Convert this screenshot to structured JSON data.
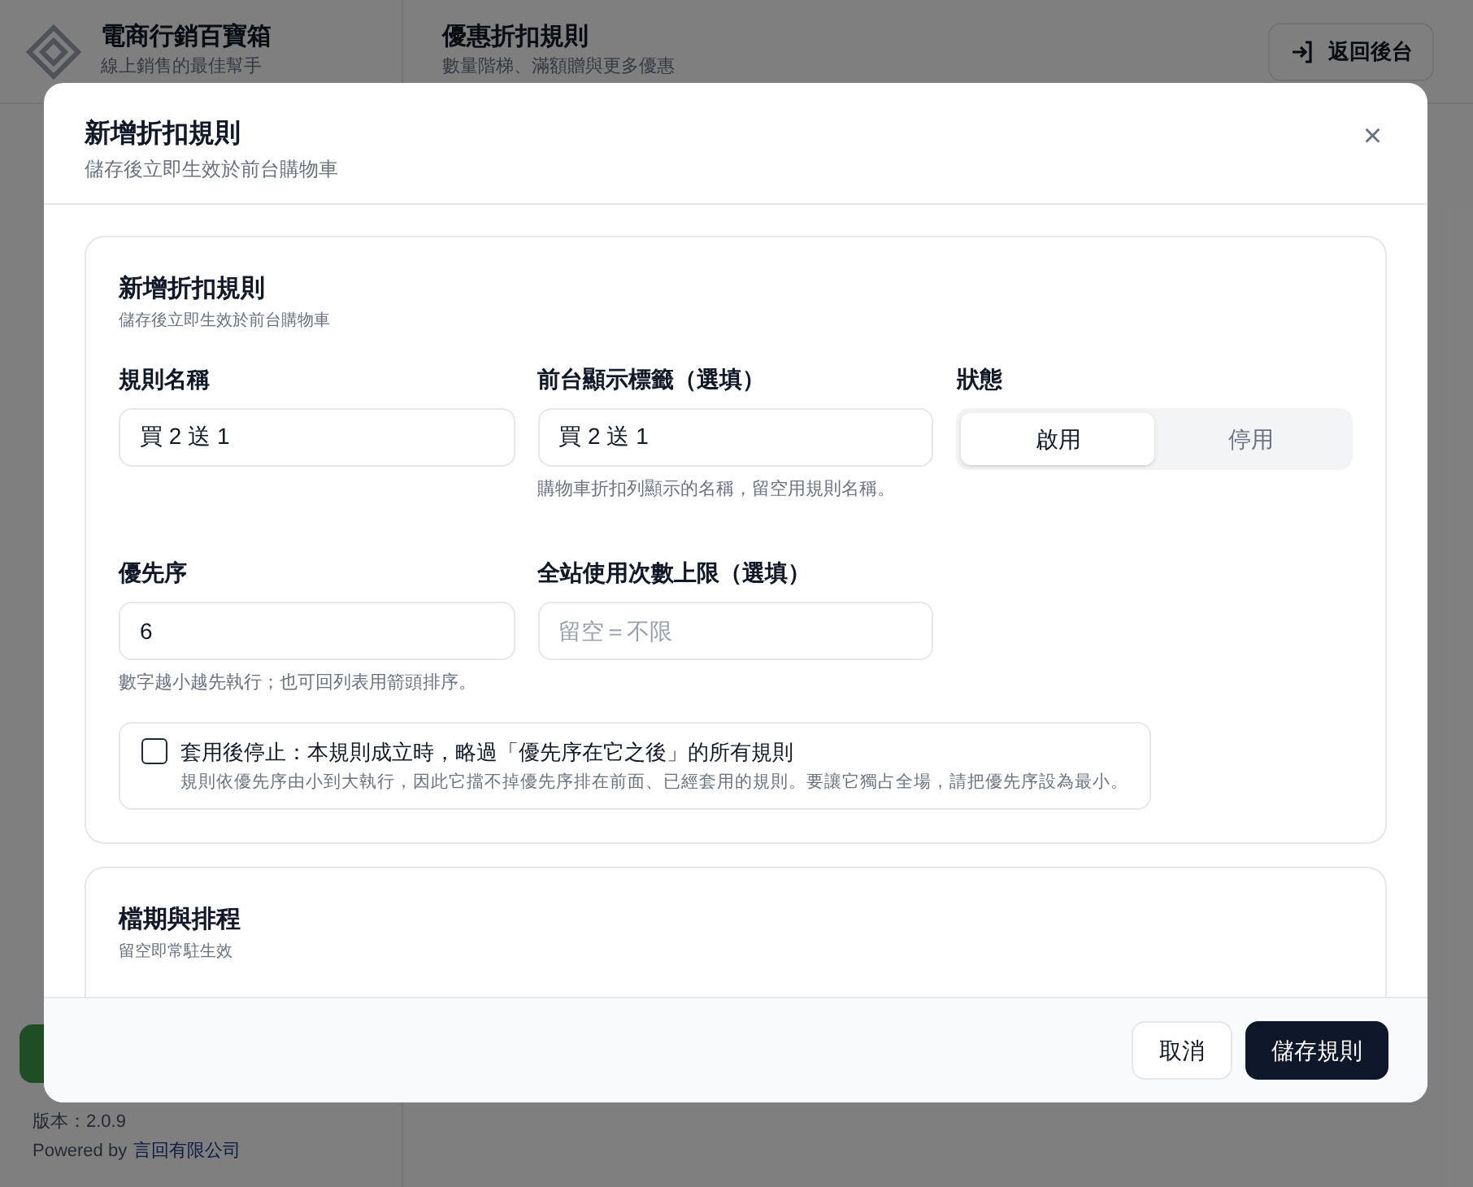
{
  "app": {
    "title": "電商行銷百寶箱",
    "subtitle": "線上銷售的最佳幫手",
    "version": "版本：2.0.9",
    "powered_by": "Powered by",
    "company_link": "言回有限公司"
  },
  "page": {
    "title": "優惠折扣規則",
    "subtitle": "數量階梯、滿額贈與更多優惠",
    "back_button": "返回後台"
  },
  "dialog": {
    "title": "新增折扣規則",
    "subtitle": "儲存後立即生效於前台購物車",
    "close": "×",
    "sections": [
      {
        "title": "新增折扣規則",
        "subtitle": "儲存後立即生效於前台購物車",
        "name_field": {
          "label": "規則名稱",
          "value": "買 2 送 1"
        },
        "display_field": {
          "label": "前台顯示標籤（選填）",
          "value": "買 2 送 1",
          "help": "購物車折扣列顯示的名稱，留空用規則名稱。"
        },
        "status": {
          "label": "狀態",
          "options": [
            {
              "label": "啟用",
              "selected": true
            },
            {
              "label": "停用",
              "selected": false
            }
          ]
        },
        "priority_field": {
          "label": "優先序",
          "value": "6",
          "help": "數字越小越先執行；也可回列表用箭頭排序。"
        },
        "limit_field": {
          "label": "全站使用次數上限（選填）",
          "placeholder": "留空＝不限"
        },
        "stop_option": {
          "checked": false,
          "label": "套用後停止：本規則成立時，略過「優先序在它之後」的所有規則",
          "help": "規則依優先序由小到大執行，因此它擋不掉優先序排在前面、已經套用的規則。要讓它獨占全場，請把優先序設為最小。"
        }
      },
      {
        "title": "檔期與排程",
        "subtitle": "留空即常駐生效"
      }
    ],
    "buttons": {
      "cancel": "取消",
      "save": "儲存規則"
    }
  }
}
